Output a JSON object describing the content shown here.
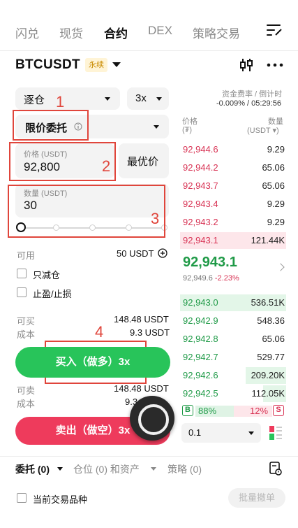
{
  "nav": {
    "tabs": [
      "闪兑",
      "现货",
      "合约",
      "DEX",
      "策略交易"
    ],
    "active": "合约",
    "menu_icon": "menu-edit-icon"
  },
  "header": {
    "symbol": "BTCUSDT",
    "badge": "永续",
    "chart_icon": "candlestick-icon",
    "more_icon": "more-horizontal-icon"
  },
  "form": {
    "margin_mode": "逐仓",
    "leverage": "3x",
    "order_type": "限价委托",
    "price_label": "价格 (USDT)",
    "price_value": "92,800",
    "best_price_button": "最优价",
    "qty_label": "数量 (USDT)",
    "qty_value": "30",
    "available_label": "可用",
    "available_value": "50 USDT",
    "reduce_only": "只减仓",
    "tp_sl": "止盈/止损",
    "buy_can_label": "可买",
    "buy_can_value": "148.48 USDT",
    "buy_cost_label": "成本",
    "buy_cost_value": "9.3 USDT",
    "buy_button": "买入（做多）3x",
    "sell_can_label": "可卖",
    "sell_can_value": "148.48 USDT",
    "sell_cost_label": "成本",
    "sell_cost_value": "9.3",
    "sell_button": "卖出（做空）3x"
  },
  "annotations": [
    "1",
    "2",
    "3",
    "4"
  ],
  "orderbook": {
    "funding_label": "资金费率 / 倒计时",
    "funding_value": "-0.009% / 05:29:56",
    "price_header": "价格",
    "price_unit": "(₮)",
    "qty_header": "数量",
    "qty_unit": "(USDT ▾)",
    "asks": [
      {
        "price": "92,944.6",
        "qty": "9.29",
        "depth": 0
      },
      {
        "price": "92,944.2",
        "qty": "65.06",
        "depth": 0
      },
      {
        "price": "92,943.7",
        "qty": "65.06",
        "depth": 0
      },
      {
        "price": "92,943.4",
        "qty": "9.29",
        "depth": 0
      },
      {
        "price": "92,943.2",
        "qty": "9.29",
        "depth": 0
      },
      {
        "price": "92,943.1",
        "qty": "121.44K",
        "depth": 1.0
      }
    ],
    "last_price": "92,943.1",
    "mark_price": "92,949.6",
    "change_pct": "-2.23%",
    "bids": [
      {
        "price": "92,943.0",
        "qty": "536.51K",
        "depth": 1.0
      },
      {
        "price": "92,942.9",
        "qty": "548.36",
        "depth": 0
      },
      {
        "price": "92,942.8",
        "qty": "65.06",
        "depth": 0
      },
      {
        "price": "92,942.7",
        "qty": "529.77",
        "depth": 0
      },
      {
        "price": "92,942.6",
        "qty": "209.20K",
        "depth": 0.38
      },
      {
        "price": "92,942.5",
        "qty": "112.05K",
        "depth": 0.22
      }
    ],
    "buy_ratio_tag": "B",
    "buy_ratio": "88%",
    "sell_ratio": "12%",
    "sell_ratio_tag": "S",
    "depth_step": "0.1"
  },
  "bottom": {
    "tabs": [
      "委托 (0)",
      "仓位 (0) 和资产",
      "策略 (0)"
    ],
    "current_pair_label": "当前交易品种",
    "batch_cancel": "批量撤单"
  },
  "colors": {
    "buy": "#28c45a",
    "sell": "#ee3b5c",
    "bid_text": "#1f9a47",
    "ask_text": "#d83354",
    "annotation": "#e0453b"
  }
}
